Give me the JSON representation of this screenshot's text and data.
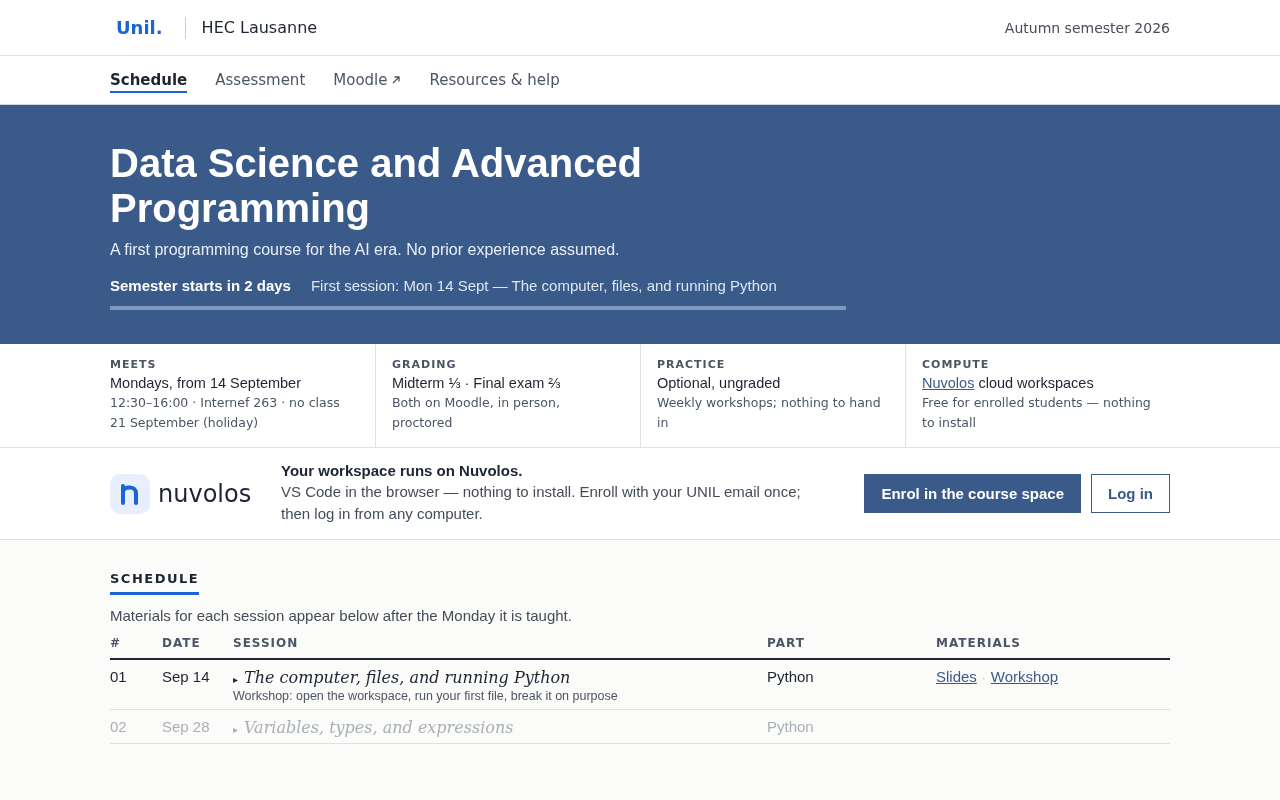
{
  "header": {
    "logo": "Unil.",
    "school": "HEC Lausanne",
    "semester": "Autumn semester 2026"
  },
  "nav": [
    {
      "label": "Schedule",
      "selected": true,
      "external": false
    },
    {
      "label": "Assessment",
      "selected": false,
      "external": false
    },
    {
      "label": "Moodle",
      "selected": false,
      "external": true
    },
    {
      "label": "Resources & help",
      "selected": false,
      "external": false
    }
  ],
  "hero": {
    "title": "Data Science and Advanced Programming",
    "subtitle": "A first programming course for the AI era. No prior experience assumed.",
    "countdown": "Semester starts in 2 days",
    "first_session": "First session: Mon 14 Sept — The computer, files, and running Python"
  },
  "facts": [
    {
      "label": "MEETS",
      "headline": "Mondays, from 14 September",
      "detail": "12:30–16:00 · Internef 263 · no class 21 September (holiday)"
    },
    {
      "label": "GRADING",
      "headline": "Midterm ⅓ · Final exam ⅔",
      "detail": "Both on Moodle, in person, proctored"
    },
    {
      "label": "PRACTICE",
      "headline": "Optional, ungraded",
      "detail": "Weekly workshops; nothing to hand in"
    },
    {
      "label": "COMPUTE",
      "link": "Nuvolos",
      "headline": "cloud workspaces",
      "detail": "Free for enrolled students — nothing to install"
    }
  ],
  "workspace": {
    "logo_text": "nuvolos",
    "title": "Your workspace runs on Nuvolos.",
    "text": "VS Code in the browser — nothing to install. Enroll with your UNIL email once; then log in from any computer.",
    "primary_button": "Enrol in the course space",
    "secondary_button": "Log in"
  },
  "schedule": {
    "heading": "SCHEDULE",
    "intro": "Materials for each session appear below after the Monday it is taught.",
    "materials_separator": "·",
    "columns": [
      "#",
      "DATE",
      "SESSION",
      "PART",
      "MATERIALS"
    ],
    "rows": [
      {
        "num": "01",
        "date": "Sep 14",
        "marker": "▸",
        "title": "The computer, files, and running Python",
        "note": "Workshop: open the workspace, run your first file, break it on purpose",
        "part": "Python",
        "materials": [
          "Slides",
          "Workshop"
        ],
        "upcoming": false
      },
      {
        "num": "02",
        "date": "Sep 28",
        "marker": "▸",
        "title": "Variables, types, and expressions",
        "part": "Python",
        "upcoming": true
      }
    ]
  }
}
